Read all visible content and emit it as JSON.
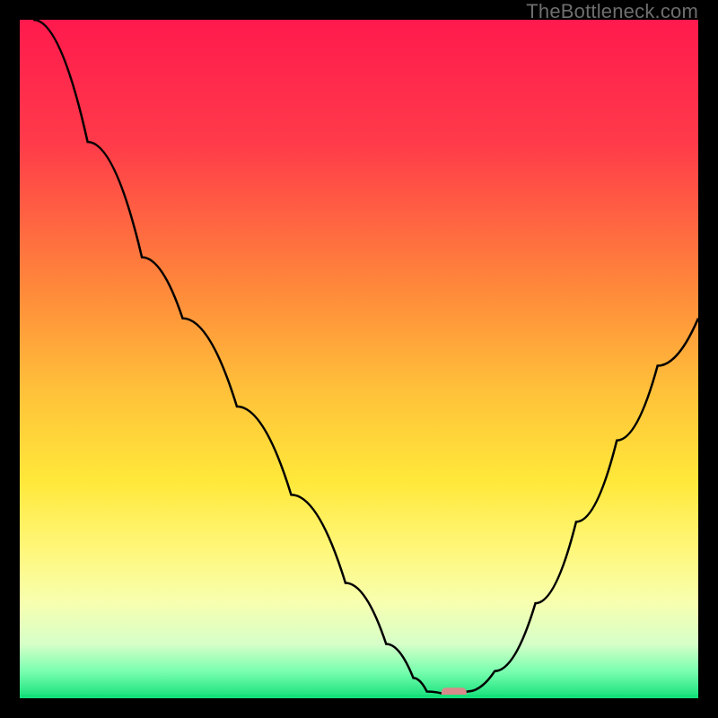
{
  "watermark": "TheBottleneck.com",
  "chart_data": {
    "type": "line",
    "title": "",
    "xlabel": "",
    "ylabel": "",
    "xlim": [
      0,
      100
    ],
    "ylim": [
      0,
      100
    ],
    "gradient_stops": [
      {
        "offset": 0,
        "color": "#ff1a4d"
      },
      {
        "offset": 18,
        "color": "#ff3a4a"
      },
      {
        "offset": 40,
        "color": "#ff8a3a"
      },
      {
        "offset": 55,
        "color": "#ffc23a"
      },
      {
        "offset": 68,
        "color": "#ffe83a"
      },
      {
        "offset": 78,
        "color": "#fff77a"
      },
      {
        "offset": 86,
        "color": "#f7ffb0"
      },
      {
        "offset": 92,
        "color": "#d6ffc8"
      },
      {
        "offset": 96,
        "color": "#7affb0"
      },
      {
        "offset": 100,
        "color": "#14e07a"
      }
    ],
    "curve_points": [
      {
        "x": 2,
        "y": 100
      },
      {
        "x": 10,
        "y": 82
      },
      {
        "x": 18,
        "y": 65
      },
      {
        "x": 24,
        "y": 56
      },
      {
        "x": 32,
        "y": 43
      },
      {
        "x": 40,
        "y": 30
      },
      {
        "x": 48,
        "y": 17
      },
      {
        "x": 54,
        "y": 8
      },
      {
        "x": 58,
        "y": 3
      },
      {
        "x": 60,
        "y": 1
      },
      {
        "x": 63,
        "y": 0.5
      },
      {
        "x": 66,
        "y": 1
      },
      {
        "x": 70,
        "y": 4
      },
      {
        "x": 76,
        "y": 14
      },
      {
        "x": 82,
        "y": 26
      },
      {
        "x": 88,
        "y": 38
      },
      {
        "x": 94,
        "y": 49
      },
      {
        "x": 100,
        "y": 56
      }
    ],
    "marker": {
      "x": 64,
      "y": 0.5,
      "color": "#d98a8a"
    },
    "baseline_color": "#14e07a"
  }
}
